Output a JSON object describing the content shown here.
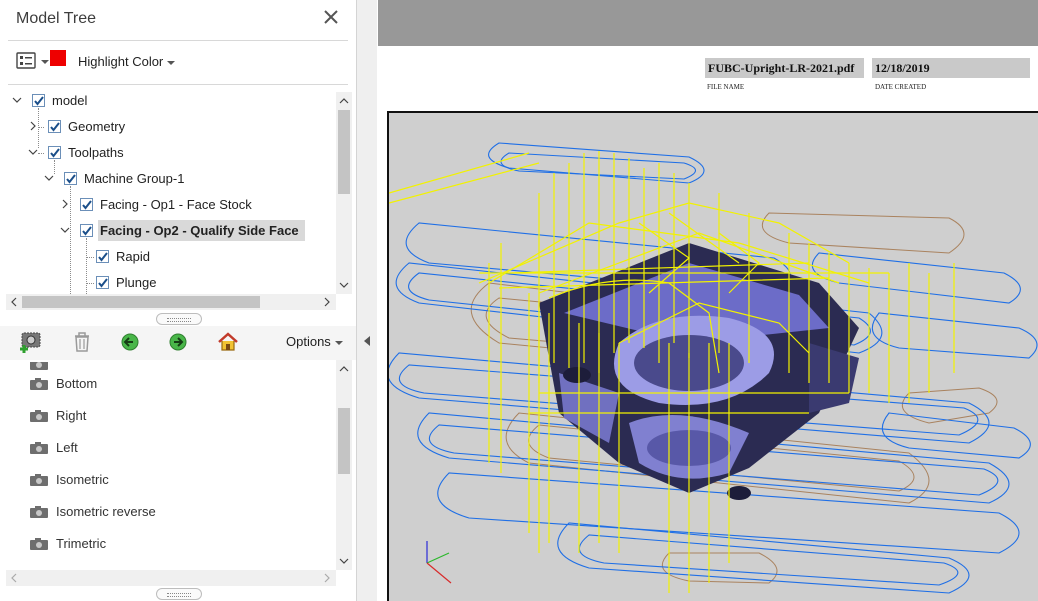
{
  "panel": {
    "title": "Model Tree",
    "highlight_label": "Highlight Color",
    "highlight_color": "#ee0000"
  },
  "tree": [
    {
      "label": "model",
      "expanded": true,
      "checked": true
    },
    {
      "label": "Geometry",
      "expanded": false,
      "checked": true
    },
    {
      "label": "Toolpaths",
      "expanded": true,
      "checked": true
    },
    {
      "label": "Machine Group-1",
      "expanded": true,
      "checked": true
    },
    {
      "label": "Facing - Op1 - Face Stock",
      "expanded": false,
      "checked": true
    },
    {
      "label": "Facing - Op2 - Qualify Side Face",
      "expanded": true,
      "checked": true,
      "selected": true
    },
    {
      "label": "Rapid",
      "checked": true
    },
    {
      "label": "Plunge",
      "checked": true
    }
  ],
  "views_toolbar": {
    "options_label": "Options",
    "icons": [
      "add-view-icon",
      "delete-view-icon",
      "previous-view-icon",
      "next-view-icon",
      "home-view-icon"
    ]
  },
  "views": [
    "Bottom",
    "Right",
    "Left",
    "Isometric",
    "Isometric reverse",
    "Trimetric"
  ],
  "document": {
    "file_name": "FUBC-Upright-LR-2021.pdf",
    "file_name_caption": "FILE NAME",
    "date_created": "12/18/2019",
    "date_created_caption": "DATE CREATED"
  },
  "colors": {
    "toolpath_yellow": "#f2f200",
    "toolpath_blue": "#1f6fe6",
    "toolpath_brown": "#a57a52",
    "part_purple": "#8a8ad6",
    "viewport_bg": "#cfcfcf"
  }
}
